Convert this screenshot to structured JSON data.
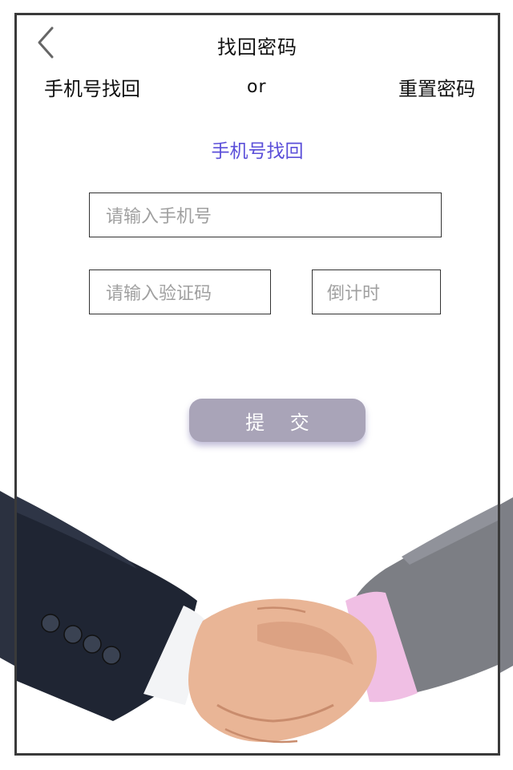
{
  "header": {
    "title": "找回密码",
    "back_icon": "chevron-left-icon"
  },
  "modes": {
    "left": "手机号找回",
    "separator": "or",
    "right": "重置密码"
  },
  "section": {
    "title": "手机号找回",
    "title_color": "#5b4fd9"
  },
  "form": {
    "phone_placeholder": "请输入手机号",
    "code_placeholder": "请输入验证码",
    "countdown_label": "倒计时",
    "submit_label": "提 交",
    "submit_color": "#a9a4b8"
  },
  "image": {
    "name": "handshake-photo"
  }
}
